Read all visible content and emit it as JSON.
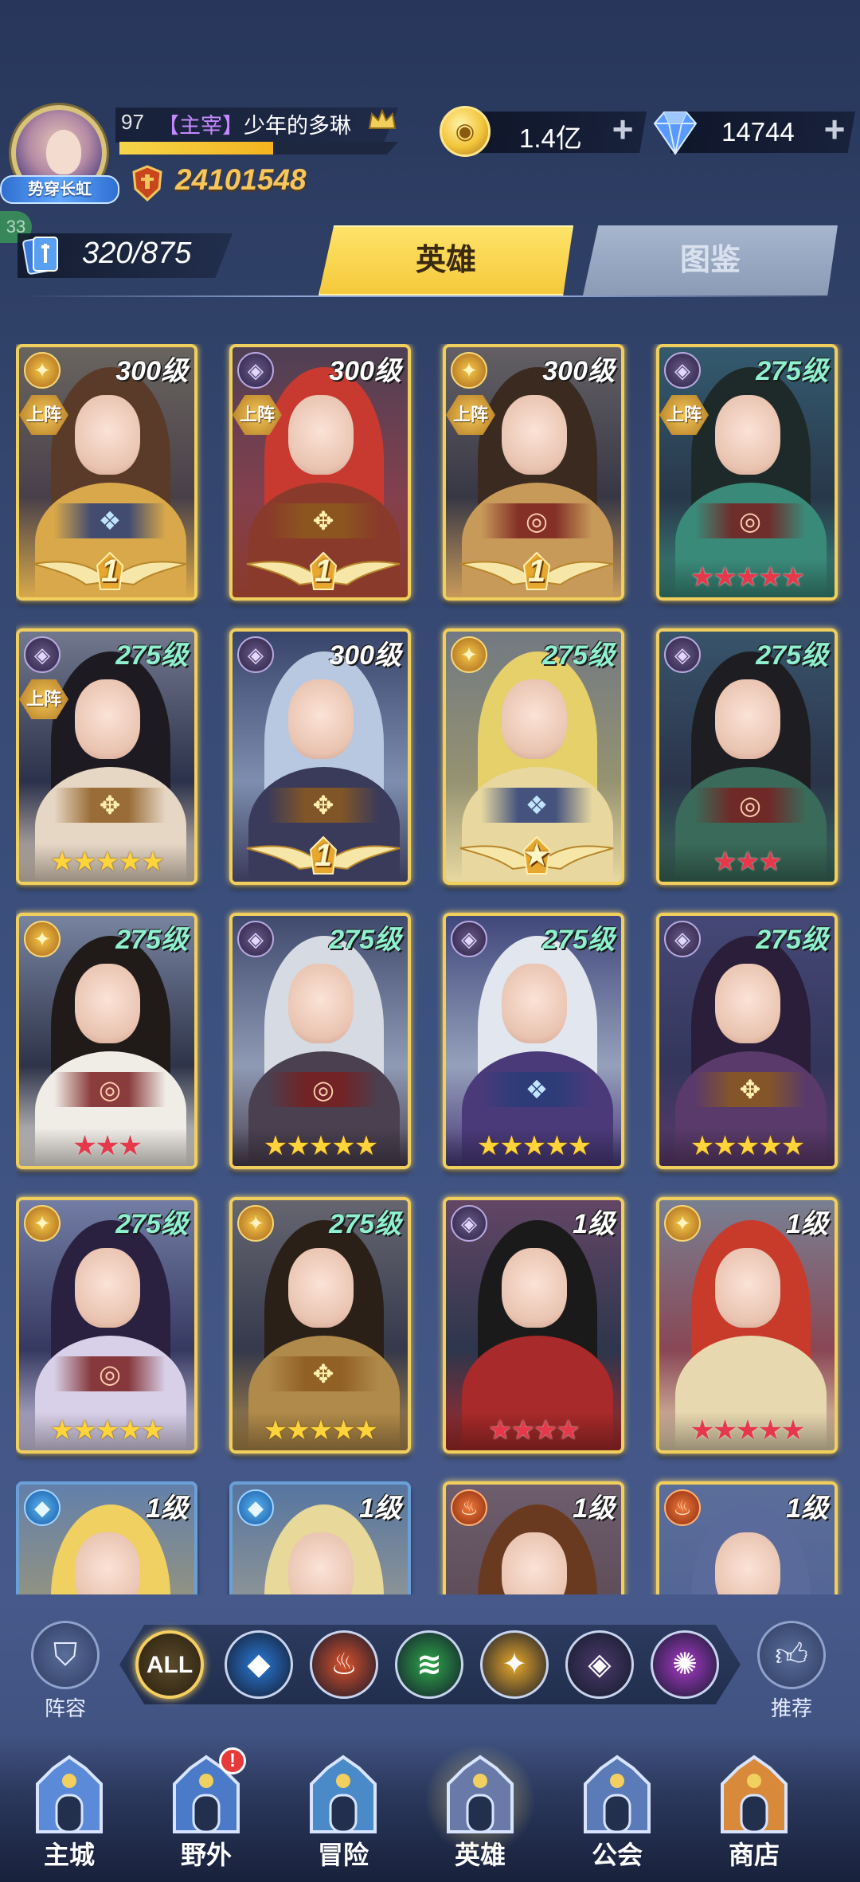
{
  "player": {
    "level": "97",
    "rank_tag": "【主宰】",
    "name": "少年的多琳",
    "title_badge": "势穿长虹",
    "xp_fraction": 0.55,
    "side_badge": "33",
    "power": "24101548",
    "hero_count": "320/875"
  },
  "currency": {
    "gold": "1.4亿",
    "diamonds": "14744",
    "plus": "+"
  },
  "tabs": {
    "heroes": "英雄",
    "codex": "图鉴"
  },
  "heroes": [
    {
      "level": "300级",
      "faction": "light",
      "deployed": true,
      "frame": "gold",
      "stars": "",
      "star_color": "",
      "wing_rank": "1",
      "emblem": "blue",
      "hair": "#5a3a28",
      "body": "#d8a84a"
    },
    {
      "level": "300级",
      "faction": "dark",
      "deployed": true,
      "frame": "gold",
      "stars": "",
      "star_color": "",
      "wing_rank": "1",
      "emblem": "gold",
      "hair": "#c83a30",
      "body": "#8a3a2a"
    },
    {
      "level": "300级",
      "faction": "light",
      "deployed": true,
      "frame": "gold",
      "stars": "",
      "star_color": "",
      "wing_rank": "1",
      "emblem": "red",
      "hair": "#3a2a20",
      "body": "#c89a5a"
    },
    {
      "level": "275级",
      "faction": "dark",
      "deployed": true,
      "frame": "gold",
      "stars": "★★★★★",
      "star_color": "red",
      "wing_rank": "",
      "emblem": "red",
      "hair": "#1e2a2a",
      "body": "#3a8a7a"
    },
    {
      "level": "275级",
      "faction": "dark",
      "deployed": true,
      "frame": "gold",
      "stars": "★★★★★",
      "star_color": "gold",
      "wing_rank": "",
      "emblem": "gold",
      "hair": "#1e1a22",
      "body": "#e6d6c4"
    },
    {
      "level": "300级",
      "faction": "dark",
      "deployed": false,
      "frame": "gold",
      "stars": "",
      "star_color": "",
      "wing_rank": "1",
      "emblem": "gold",
      "hair": "#b8c8e0",
      "body": "#3a3a5a"
    },
    {
      "level": "275级",
      "faction": "light",
      "deployed": false,
      "frame": "gold",
      "stars": "",
      "star_color": "",
      "wing_rank": "★",
      "emblem": "blue",
      "hair": "#e6d06a",
      "body": "#e8d8a0"
    },
    {
      "level": "275级",
      "faction": "dark",
      "deployed": false,
      "frame": "gold",
      "stars": "★★★",
      "star_color": "red",
      "wing_rank": "",
      "emblem": "red",
      "hair": "#1e1e22",
      "body": "#3a6a5a"
    },
    {
      "level": "275级",
      "faction": "light",
      "deployed": false,
      "frame": "gold",
      "stars": "★★★",
      "star_color": "red",
      "wing_rank": "",
      "emblem": "red",
      "hair": "#201a18",
      "body": "#f0ece6"
    },
    {
      "level": "275级",
      "faction": "dark",
      "deployed": false,
      "frame": "gold",
      "stars": "★★★★★",
      "star_color": "gold",
      "wing_rank": "",
      "emblem": "red",
      "hair": "#d6dae2",
      "body": "#4a4050"
    },
    {
      "level": "275级",
      "faction": "dark",
      "deployed": false,
      "frame": "gold",
      "stars": "★★★★★",
      "star_color": "gold",
      "wing_rank": "",
      "emblem": "blue",
      "hair": "#e2e6ee",
      "body": "#4a3a7a"
    },
    {
      "level": "275级",
      "faction": "dark",
      "deployed": false,
      "frame": "gold",
      "stars": "★★★★★",
      "star_color": "gold",
      "wing_rank": "",
      "emblem": "gold",
      "hair": "#2a1e3a",
      "body": "#5a3a6a"
    },
    {
      "level": "275级",
      "faction": "light",
      "deployed": false,
      "frame": "gold",
      "stars": "★★★★★",
      "star_color": "gold",
      "wing_rank": "",
      "emblem": "red",
      "hair": "#2a2040",
      "body": "#d8d0e8"
    },
    {
      "level": "275级",
      "faction": "light",
      "deployed": false,
      "frame": "gold",
      "stars": "★★★★★",
      "star_color": "gold",
      "wing_rank": "",
      "emblem": "gold",
      "hair": "#2a2018",
      "body": "#b08a4a"
    },
    {
      "level": "1级",
      "faction": "dark",
      "deployed": false,
      "frame": "gold",
      "stars": "★★★★",
      "star_color": "red",
      "wing_rank": "",
      "emblem": "",
      "hair": "#1a1a1a",
      "body": "#a82a2a"
    },
    {
      "level": "1级",
      "faction": "light",
      "deployed": false,
      "frame": "gold",
      "stars": "★★★★★",
      "star_color": "red",
      "wing_rank": "",
      "emblem": "",
      "hair": "#c83a2a",
      "body": "#e8d8b0"
    },
    {
      "level": "1级",
      "faction": "water",
      "deployed": false,
      "frame": "blue",
      "stars": "",
      "star_color": "",
      "wing_rank": "",
      "emblem": "",
      "hair": "#f0d060",
      "body": "#a0d0f0"
    },
    {
      "level": "1级",
      "faction": "water",
      "deployed": false,
      "frame": "blue",
      "stars": "",
      "star_color": "",
      "wing_rank": "",
      "emblem": "",
      "hair": "#e8d89a",
      "body": "#7ab0d0"
    },
    {
      "level": "1级",
      "faction": "fire",
      "deployed": false,
      "frame": "gold",
      "stars": "",
      "star_color": "",
      "wing_rank": "",
      "emblem": "",
      "hair": "#6a3a20",
      "body": "#c06a3a"
    },
    {
      "level": "1级",
      "faction": "fire",
      "deployed": false,
      "frame": "gold",
      "stars": "",
      "star_color": "",
      "wing_rank": "",
      "emblem": "",
      "hair": "#5a6a9a",
      "body": "#8a9ac0"
    }
  ],
  "deploy_label": "上阵",
  "filters": {
    "lineup_label": "阵容",
    "recommend_label": "推荐",
    "all_label": "ALL",
    "factions": [
      {
        "name": "water",
        "glyph": "◆",
        "color": "#2a7ad8"
      },
      {
        "name": "fire",
        "glyph": "♨",
        "color": "#d8502a"
      },
      {
        "name": "wind",
        "glyph": "≋",
        "color": "#2ea84a"
      },
      {
        "name": "light",
        "glyph": "✦",
        "color": "#e8a82a"
      },
      {
        "name": "dark",
        "glyph": "◈",
        "color": "#4a3a6a"
      },
      {
        "name": "arcane",
        "glyph": "✺",
        "color": "#a83ac8"
      }
    ]
  },
  "nav": {
    "items": [
      {
        "label": "主城",
        "icon": "castle-icon",
        "active": false,
        "alert": false
      },
      {
        "label": "野外",
        "icon": "field-icon",
        "active": false,
        "alert": true
      },
      {
        "label": "冒险",
        "icon": "adventure-icon",
        "active": false,
        "alert": false
      },
      {
        "label": "英雄",
        "icon": "hero-helmet-icon",
        "active": true,
        "alert": false
      },
      {
        "label": "公会",
        "icon": "guild-icon",
        "active": false,
        "alert": false
      },
      {
        "label": "商店",
        "icon": "shop-icon",
        "active": false,
        "alert": false
      }
    ],
    "alert_mark": "!"
  },
  "colors": {
    "accent_gold": "#f4c93a",
    "power_gold": "#f7c65a",
    "star_red": "#e5384a",
    "star_gold": "#ffd43a",
    "level_green": "#8ff0d0"
  }
}
